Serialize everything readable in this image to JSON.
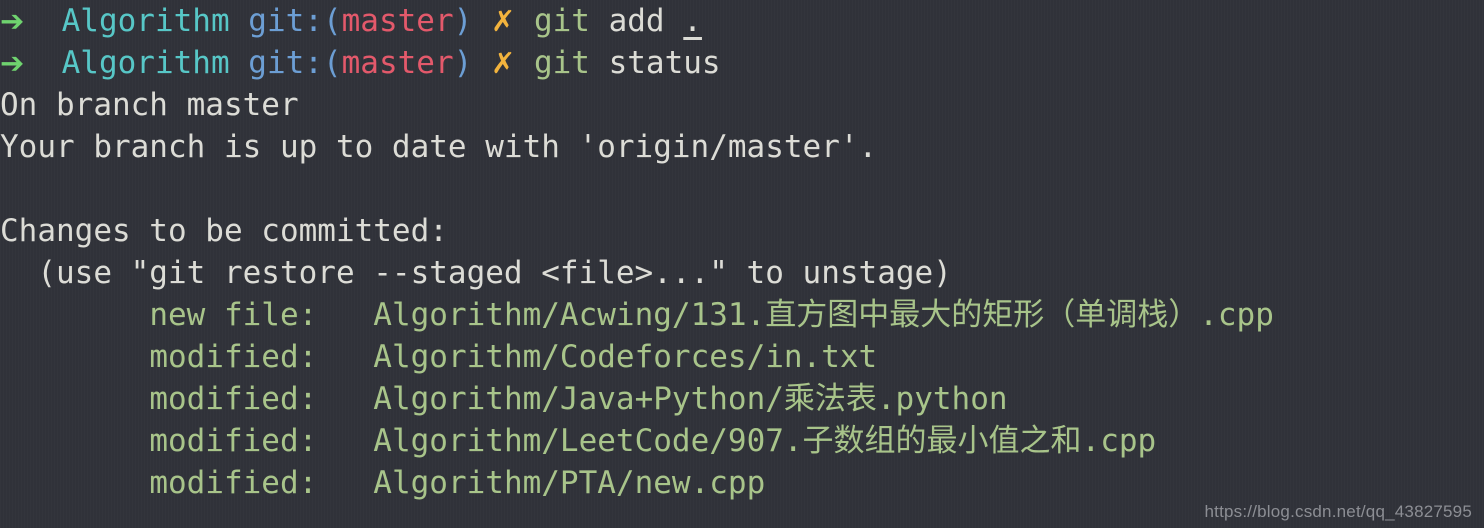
{
  "terminal": {
    "background_color": "#31333a",
    "foreground_color": "#dcdcd6",
    "prompt_colors": {
      "arrow": "#6fd36f",
      "directory": "#57c7c7",
      "git_label": "#6c9ed4",
      "branch": "#e3596b",
      "dirty_marker": "#f2b33d",
      "command": "#a8c48a",
      "staged_file": "#a8c48a"
    }
  },
  "prompt": {
    "arrow_icon": "arrow-right-icon",
    "arrow_glyph": "➔",
    "directory": "Algorithm",
    "git_label": "git:(",
    "branch": "master",
    "git_label_close": ")",
    "dirty_marker": "✗",
    "dirty_icon": "cross-mark-icon"
  },
  "commands": [
    {
      "program": "git",
      "args": "add",
      "path_arg": "."
    },
    {
      "program": "git",
      "args": "status",
      "path_arg": ""
    }
  ],
  "output": {
    "branch_line": "On branch master",
    "tracking_line": "Your branch is up to date with 'origin/master'.",
    "changes_header": "Changes to be committed:",
    "changes_hint": "  (use \"git restore --staged <file>...\" to unstage)",
    "files": [
      {
        "status": "new file:",
        "indent": "        ",
        "gap": "   ",
        "path": "Algorithm/Acwing/131.直方图中最大的矩形（单调栈）.cpp"
      },
      {
        "status": "modified:",
        "indent": "        ",
        "gap": "   ",
        "path": "Algorithm/Codeforces/in.txt"
      },
      {
        "status": "modified:",
        "indent": "        ",
        "gap": "   ",
        "path": "Algorithm/Java+Python/乘法表.python"
      },
      {
        "status": "modified:",
        "indent": "        ",
        "gap": "   ",
        "path": "Algorithm/LeetCode/907.子数组的最小值之和.cpp"
      },
      {
        "status": "modified:",
        "indent": "        ",
        "gap": "   ",
        "path": "Algorithm/PTA/new.cpp"
      }
    ]
  },
  "watermark": {
    "text": "https://blog.csdn.net/qq_43827595"
  }
}
